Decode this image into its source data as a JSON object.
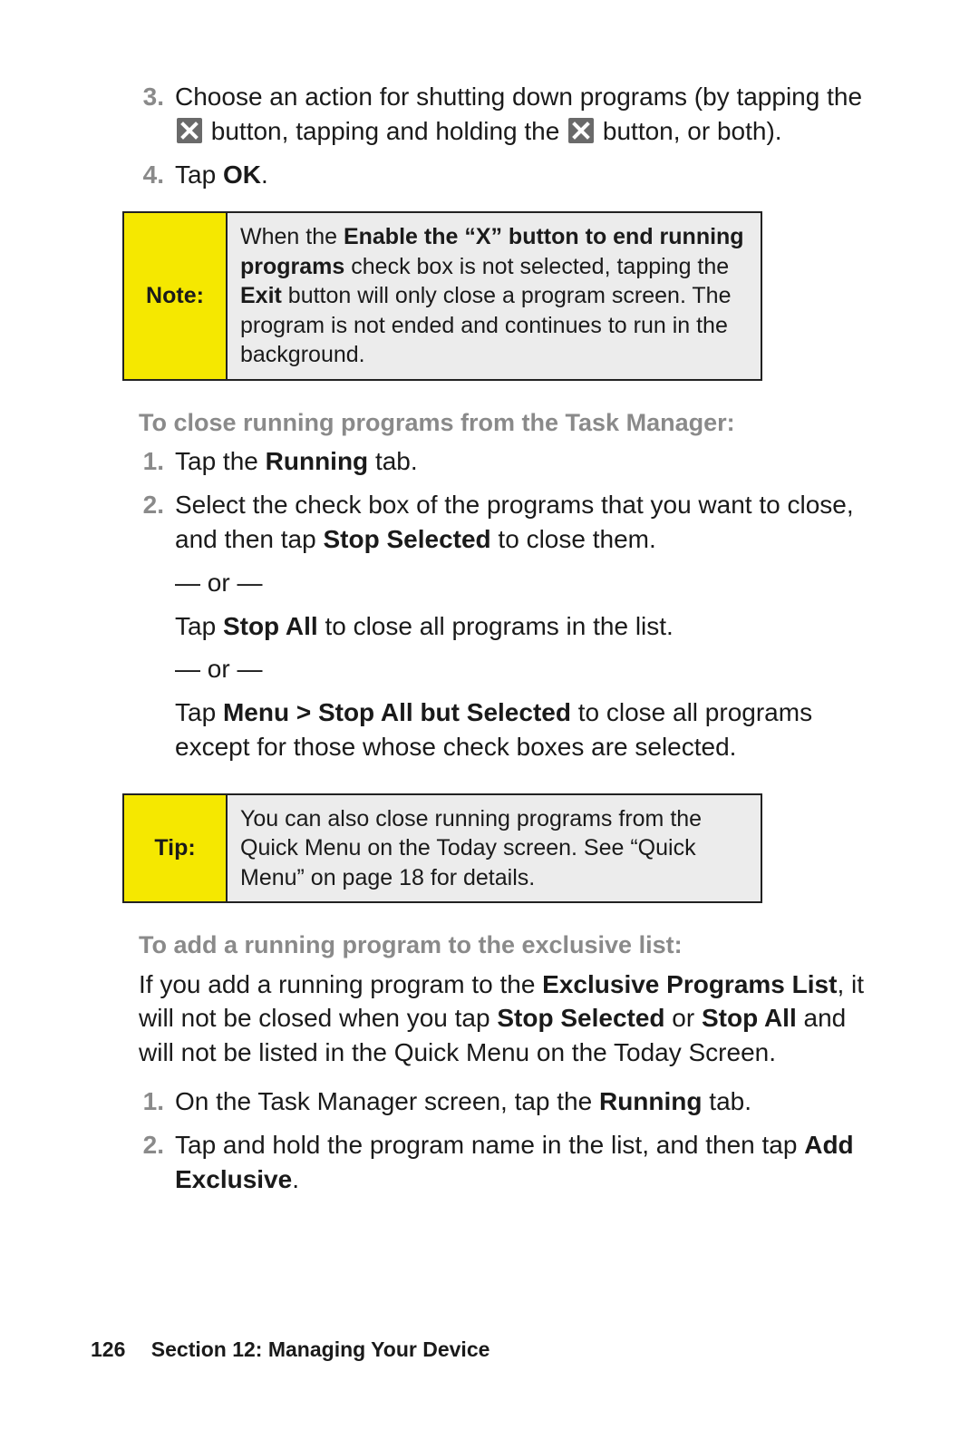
{
  "steps_top": {
    "s3_num": "3.",
    "s3_a": "Choose an action for shutting down programs (by tapping the ",
    "s3_b": " button, tapping and holding the ",
    "s3_c": " button, or both).",
    "s4_num": "4.",
    "s4_a": "Tap ",
    "s4_bold": "OK",
    "s4_b": "."
  },
  "note": {
    "label": "Note:",
    "a": "When the ",
    "bold1": "Enable the “X” button to end running programs",
    "b": " check box is not selected, tapping the ",
    "bold2": "Exit",
    "c": " button will only close a program screen. The program is not ended and continues to run in the background."
  },
  "heading1": "To close running programs from the Task Manager:",
  "steps_mid": {
    "s1_num": "1.",
    "s1_a": "Tap the ",
    "s1_bold": "Running",
    "s1_b": " tab.",
    "s2_num": "2.",
    "s2_a": "Select the check box of the programs that you want to close, and then tap ",
    "s2_bold1": "Stop Selected",
    "s2_b": " to close them.",
    "or1": "— or —",
    "s2c_a": "Tap ",
    "s2c_bold": "Stop All",
    "s2c_b": " to close all programs in the list.",
    "or2": "— or —",
    "s2d_a": "Tap ",
    "s2d_bold": "Menu > Stop All but Selected",
    "s2d_b": " to close all programs except for those whose check boxes are selected."
  },
  "tip": {
    "label": "Tip:",
    "text": "You can also close running programs from the Quick Menu on the Today screen. See “Quick Menu” on page 18 for details."
  },
  "heading2": "To add a running program to the exclusive list:",
  "intro2": {
    "a": "If you add a running program to the ",
    "bold1": "Exclusive Programs List",
    "b": ", it will not be closed when you tap ",
    "bold2": "Stop Selected",
    "c": " or ",
    "bold3": "Stop All",
    "d": " and will not be listed in the Quick Menu on the Today Screen."
  },
  "steps_bot": {
    "s1_num": "1.",
    "s1_a": "On the Task Manager screen, tap the ",
    "s1_bold": "Running",
    "s1_b": " tab.",
    "s2_num": "2.",
    "s2_a": " Tap and hold the program name in the list, and then tap ",
    "s2_bold": "Add Exclusive",
    "s2_b": "."
  },
  "footer": {
    "page": "126",
    "section": "Section 12: Managing Your Device"
  }
}
